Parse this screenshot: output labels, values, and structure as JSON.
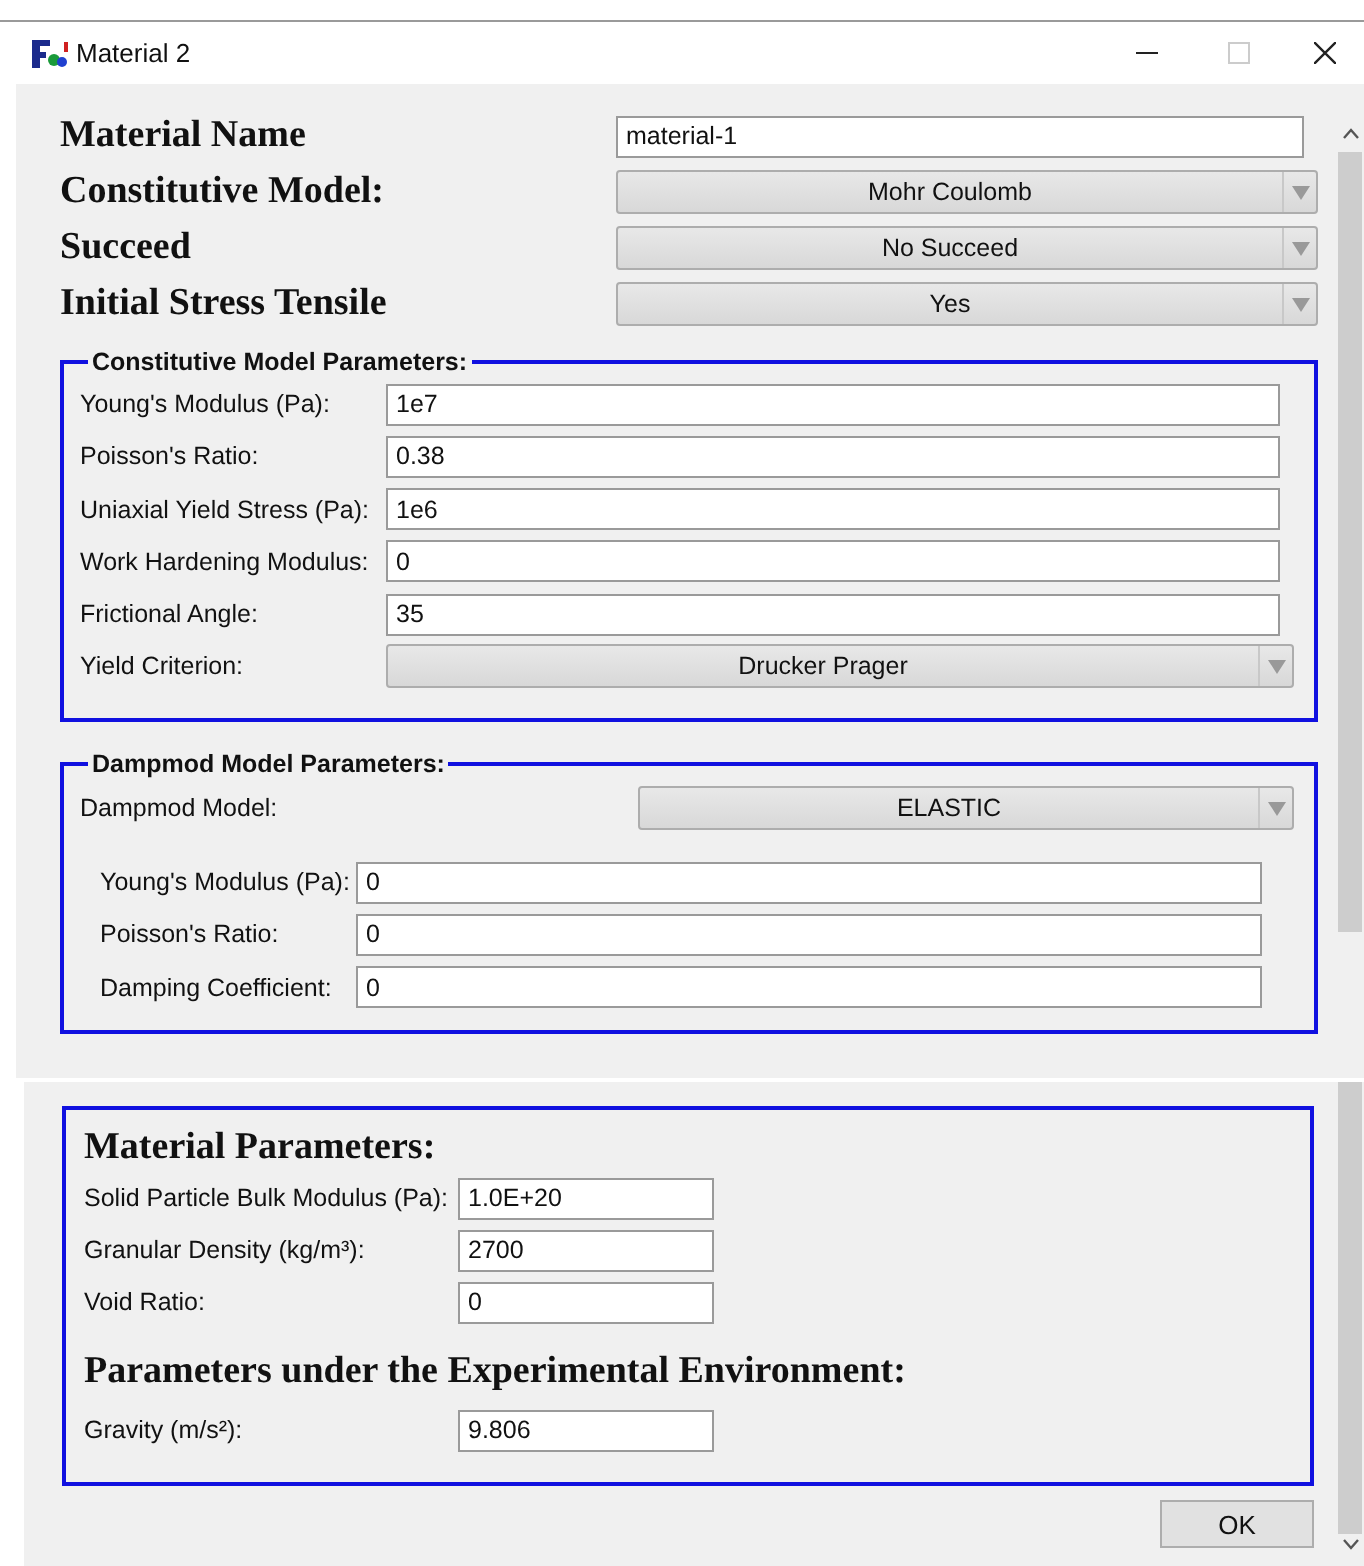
{
  "window": {
    "title": "Material 2"
  },
  "header_fields": [
    {
      "kind": "text",
      "label": "Material Name",
      "value": "material-1"
    },
    {
      "kind": "combo",
      "label": "Constitutive Model:",
      "value": "Mohr Coulomb"
    },
    {
      "kind": "combo",
      "label": "Succeed",
      "value": "No Succeed"
    },
    {
      "kind": "combo",
      "label": "Initial Stress Tensile",
      "value": "Yes"
    }
  ],
  "groups": [
    {
      "title": "Constitutive Model Parameters:",
      "rows": [
        {
          "kind": "text",
          "label": "Young's Modulus (Pa):",
          "value": "1e7"
        },
        {
          "kind": "text",
          "label": "Poisson's Ratio:",
          "value": "0.38"
        },
        {
          "kind": "text",
          "label": "Uniaxial Yield Stress (Pa):",
          "value": "1e6"
        },
        {
          "kind": "text",
          "label": "Work Hardening Modulus:",
          "value": "0"
        },
        {
          "kind": "text",
          "label": "Frictional Angle:",
          "value": "35"
        },
        {
          "kind": "combo",
          "label": "Yield Criterion:",
          "value": "Drucker Prager"
        }
      ]
    },
    {
      "title": "Dampmod Model Parameters:",
      "model": {
        "label": "Dampmod Model:",
        "value": "ELASTIC"
      },
      "rows": [
        {
          "kind": "text",
          "label": "Young's Modulus (Pa):",
          "value": "0"
        },
        {
          "kind": "text",
          "label": "Poisson's Ratio:",
          "value": "0"
        },
        {
          "kind": "text",
          "label": "Damping Coefficient:",
          "value": "0"
        }
      ]
    }
  ],
  "material_panel": {
    "sections": [
      {
        "heading": "Material Parameters:",
        "rows": [
          {
            "label": "Solid Particle Bulk Modulus (Pa):",
            "value": "1.0E+20"
          },
          {
            "label": "Granular Density (kg/m³):",
            "value": "2700"
          },
          {
            "label": "Void Ratio:",
            "value": "0"
          }
        ]
      },
      {
        "heading": "Parameters under the Experimental Environment:",
        "rows": [
          {
            "label": "Gravity (m/s²):",
            "value": "9.806"
          }
        ]
      }
    ]
  },
  "buttons": [
    "OK"
  ]
}
